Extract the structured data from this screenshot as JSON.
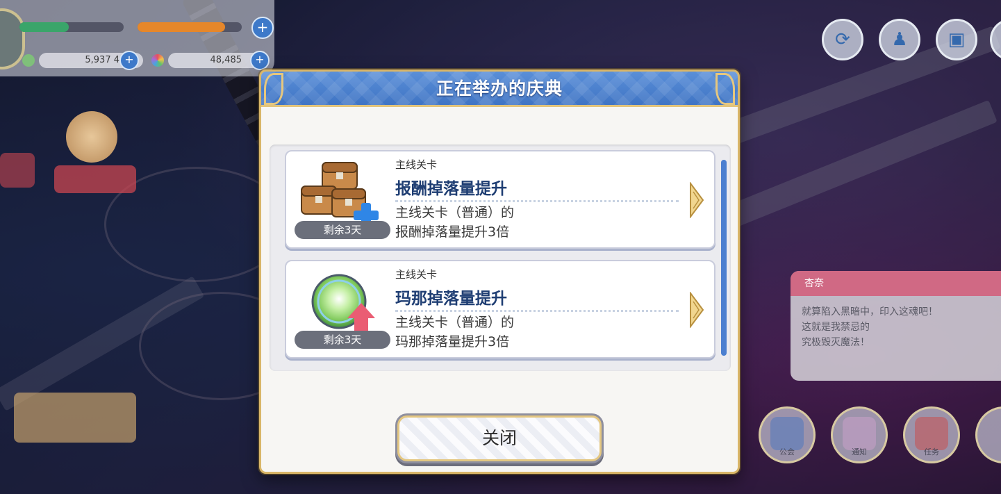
{
  "background": {
    "hud": {
      "currency_left": "5,937 4",
      "currency_right": "48,485",
      "exp_fill": 0.47,
      "stamina_fill": 0.84
    },
    "speech": {
      "name": "杏奈",
      "text_lines": [
        "就算陷入黑暗中，印入这魂吧！",
        "这就是我禁忌的",
        "究极毁灭魔法！"
      ]
    },
    "menu_buttons": [
      "公会",
      "通知",
      "任务"
    ]
  },
  "dialog": {
    "title": "正在举办的庆典",
    "events": [
      {
        "category": "主线关卡",
        "title": "报酬掉落量提升",
        "desc_line1": "主线关卡（普通）的",
        "desc_line2": "报酬掉落量提升3倍",
        "remaining": "剩余3天",
        "icon": "treasure-chest-plus-icon"
      },
      {
        "category": "主线关卡",
        "title": "玛那掉落量提升",
        "desc_line1": "主线关卡（普通）的",
        "desc_line2": "玛那掉落量提升3倍",
        "remaining": "剩余3天",
        "icon": "mana-orb-up-icon"
      }
    ],
    "close_label": "关闭"
  },
  "colors": {
    "header_blue": "#4a80cf",
    "gold_border": "#d9b668",
    "title_navy": "#1f3e73",
    "scroll_blue": "#4b7fd0"
  }
}
